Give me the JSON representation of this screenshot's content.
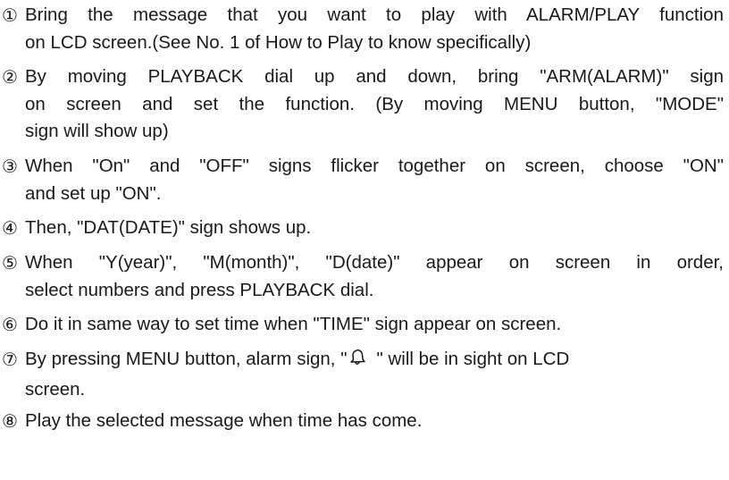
{
  "steps": [
    {
      "number": "①",
      "lines": [
        "Bring the message that you want to play with ALARM/PLAY function",
        "on LCD screen.(See No. 1 of How to Play to know specifically)"
      ]
    },
    {
      "number": "②",
      "lines": [
        "By moving PLAYBACK dial up and down, bring \"ARM(ALARM)\" sign",
        "on screen and set the function. (By moving MENU button, \"MODE\"",
        "sign will show up)"
      ]
    },
    {
      "number": "③",
      "lines": [
        "When \"On\" and \"OFF\" signs flicker together on screen, choose \"ON\"",
        "and set up \"ON\"."
      ]
    },
    {
      "number": "④",
      "lines": [
        "Then, \"DAT(DATE)\" sign shows up."
      ]
    },
    {
      "number": "⑤",
      "lines": [
        "When \"Y(year)\", \"M(month)\", \"D(date)\" appear on screen in order,",
        "select numbers and press PLAYBACK dial."
      ]
    },
    {
      "number": "⑥",
      "lines": [
        "Do it in same way to set time when \"TIME\" sign appear on screen."
      ]
    },
    {
      "number": "⑦",
      "line1_before_icon": "By pressing MENU button, alarm sign, \"",
      "line1_after_icon": "\" will be in sight on LCD",
      "lines": [
        "screen."
      ],
      "icon": "bell-icon"
    },
    {
      "number": "⑧",
      "lines": [
        "Play the selected message when time has come."
      ]
    }
  ]
}
